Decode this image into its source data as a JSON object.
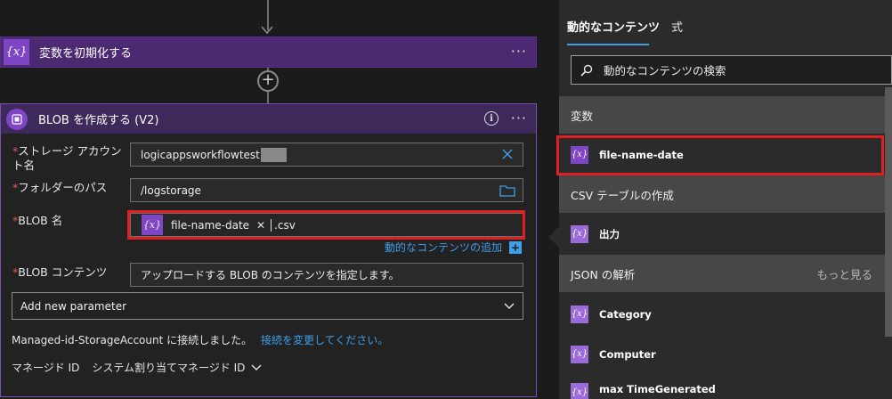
{
  "init_card": {
    "title": "変数を初期化する",
    "badge": "{x}"
  },
  "blob_card": {
    "title": "BLOB を作成する (V2)",
    "fields": {
      "storage_label": "ストレージ アカウント名",
      "storage_value": "logicappsworkflowtest",
      "folder_label": "フォルダーのパス",
      "folder_value": "/logstorage",
      "blob_name_label": "BLOB 名",
      "blob_token": "file-name-date",
      "blob_suffix": ".csv",
      "content_label": "BLOB コンテンツ",
      "content_placeholder": "アップロードする BLOB のコンテンツを指定します。"
    },
    "dynamic_link": "動的なコンテンツの追加",
    "add_param": "Add new parameter",
    "connection_text": "Managed-id-StorageAccount に接続しました。",
    "change_connection": "接続を変更してください。",
    "identity_label": "マネージド ID",
    "identity_value": "システム割り当てマネージド ID"
  },
  "panel": {
    "tab_dynamic": "動的なコンテンツ",
    "tab_expression": "式",
    "search_placeholder": "動的なコンテンツの検索",
    "sections": {
      "variables": "変数",
      "csv": "CSV テーブルの作成",
      "json": "JSON の解析",
      "see_more": "もっと見る"
    },
    "items": {
      "file_name_date": "file-name-date",
      "output": "出力",
      "category": "Category",
      "computer": "Computer",
      "max_time": "max TimeGenerated"
    }
  },
  "colors": {
    "accent_purple": "#7e45c4",
    "highlight_red": "#e02020",
    "link_blue": "#3f9ee8"
  }
}
